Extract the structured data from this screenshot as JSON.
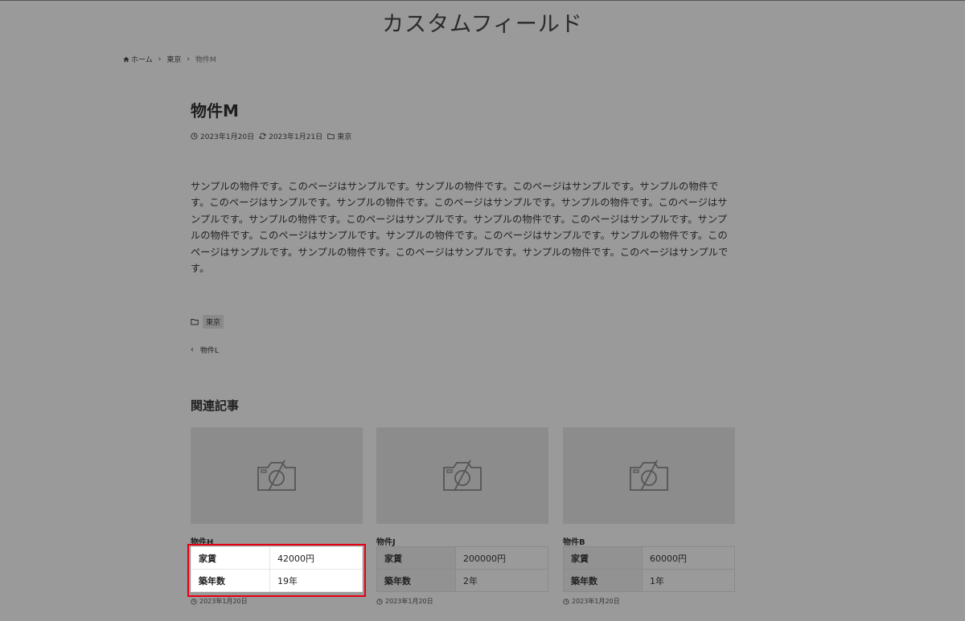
{
  "site": {
    "title": "カスタムフィールド"
  },
  "breadcrumb": {
    "home": "ホーム",
    "category": "東京",
    "current": "物件M",
    "sep": "›"
  },
  "post": {
    "title": "物件M",
    "published": "2023年1月20日",
    "updated": "2023年1月21日",
    "category": "東京",
    "body": "サンプルの物件です。このページはサンプルです。サンプルの物件です。このページはサンプルです。サンプルの物件です。このページはサンプルです。サンプルの物件です。このページはサンプルです。サンプルの物件です。このページはサンプルです。サンプルの物件です。このページはサンプルです。サンプルの物件です。このページはサンプルです。サンプルの物件です。このページはサンプルです。サンプルの物件です。このページはサンプルです。サンプルの物件です。このページはサンプルです。サンプルの物件です。このページはサンプルです。サンプルの物件です。このページはサンプルです。"
  },
  "tags": {
    "category": "東京"
  },
  "nav": {
    "prev": "物件L",
    "chevron": "‹"
  },
  "related": {
    "heading": "関連記事",
    "cards": [
      {
        "title": "物件H",
        "rows": [
          {
            "key": "家賃",
            "value": "42000円"
          },
          {
            "key": "築年数",
            "value": "19年"
          }
        ],
        "date": "2023年1月20日"
      },
      {
        "title": "物件J",
        "rows": [
          {
            "key": "家賃",
            "value": "200000円"
          },
          {
            "key": "築年数",
            "value": "2年"
          }
        ],
        "date": "2023年1月20日"
      },
      {
        "title": "物件B",
        "rows": [
          {
            "key": "家賃",
            "value": "60000円"
          },
          {
            "key": "築年数",
            "value": "1年"
          }
        ],
        "date": "2023年1月20日"
      }
    ]
  },
  "colors": {
    "highlight": "#e60012",
    "overlay": "#9a9a9a"
  },
  "icons": {
    "home": "home-icon",
    "clock": "clock-icon",
    "refresh": "refresh-icon",
    "folder": "folder-icon",
    "no_image": "camera-off-icon"
  }
}
